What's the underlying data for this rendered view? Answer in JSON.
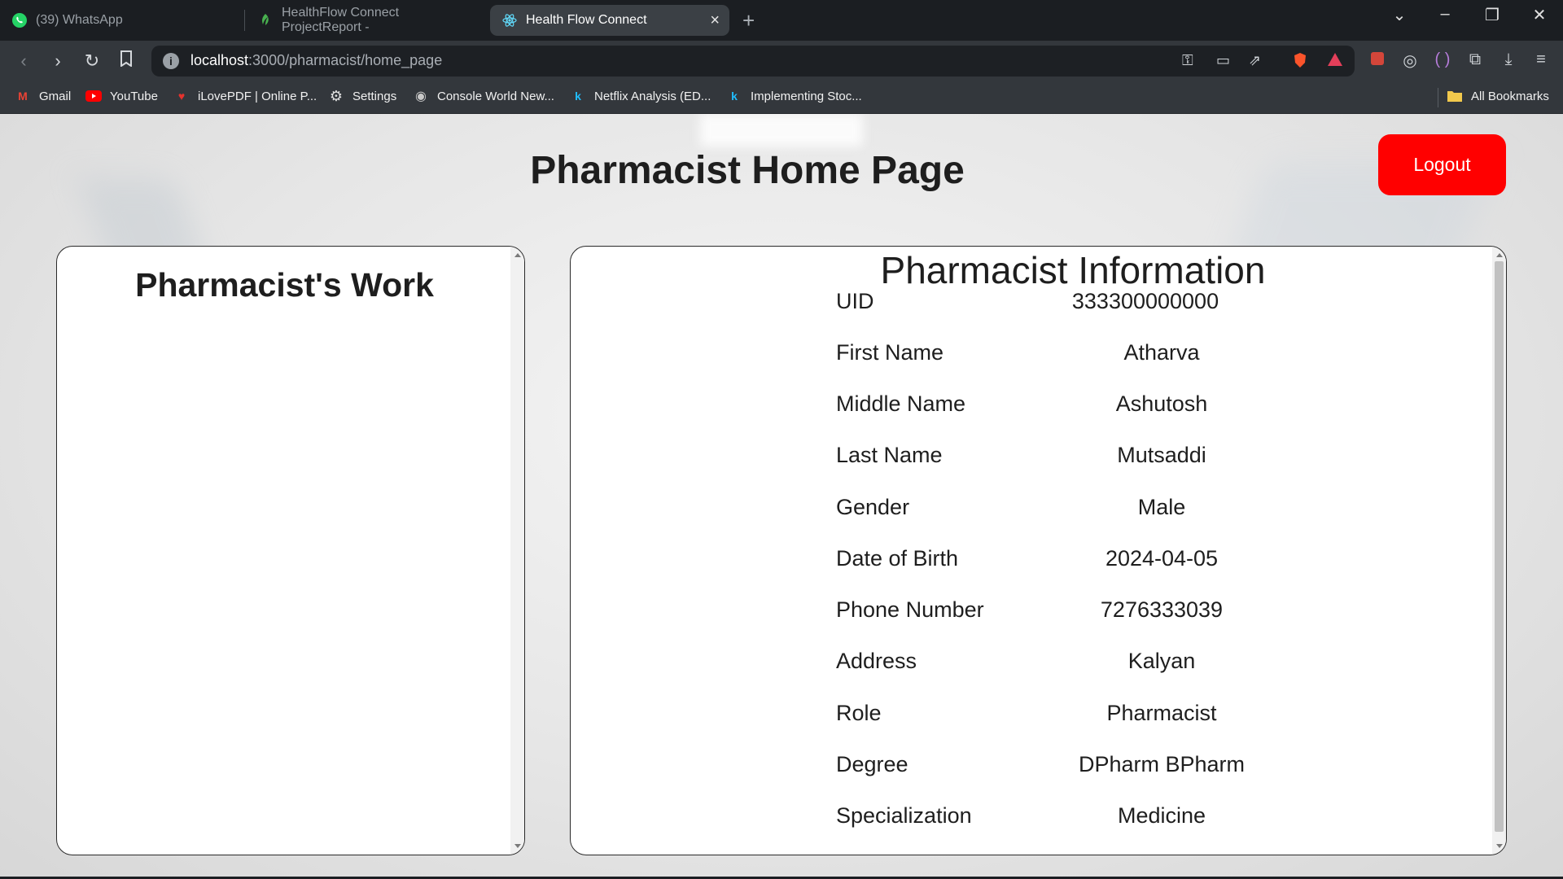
{
  "browser": {
    "tabs": [
      {
        "label": "(39) WhatsApp",
        "icon": "whatsapp-icon",
        "active": false
      },
      {
        "label": "HealthFlow Connect ProjectReport -",
        "icon": "leaf-icon",
        "active": false
      },
      {
        "label": "Health Flow Connect",
        "icon": "react-icon",
        "active": true
      }
    ],
    "url_host": "localhost",
    "url_rest": ":3000/pharmacist/home_page",
    "bookmarks": [
      {
        "label": "Gmail",
        "icon": "gmail-icon"
      },
      {
        "label": "YouTube",
        "icon": "youtube-icon"
      },
      {
        "label": "iLovePDF | Online P...",
        "icon": "ilovepdf-icon"
      },
      {
        "label": "Settings",
        "icon": "gear-icon"
      },
      {
        "label": "Console World New...",
        "icon": "globe-icon"
      },
      {
        "label": "Netflix Analysis (ED...",
        "icon": "kaggle-icon"
      },
      {
        "label": "Implementing Stoc...",
        "icon": "kaggle-icon"
      }
    ],
    "all_bookmarks": "All Bookmarks"
  },
  "page": {
    "title": "Pharmacist Home Page",
    "logout_label": "Logout",
    "left_heading": "Pharmacist's Work",
    "right_heading": "Pharmacist Information",
    "info": [
      {
        "label": "UID",
        "value": "333300000000"
      },
      {
        "label": "First Name",
        "value": "Atharva"
      },
      {
        "label": "Middle Name",
        "value": "Ashutosh"
      },
      {
        "label": "Last Name",
        "value": "Mutsaddi"
      },
      {
        "label": "Gender",
        "value": "Male"
      },
      {
        "label": "Date of Birth",
        "value": "2024-04-05"
      },
      {
        "label": "Phone Number",
        "value": "7276333039"
      },
      {
        "label": "Address",
        "value": "Kalyan"
      },
      {
        "label": "Role",
        "value": "Pharmacist"
      },
      {
        "label": "Degree",
        "value": "DPharm BPharm"
      },
      {
        "label": "Specialization",
        "value": "Medicine"
      }
    ]
  },
  "colors": {
    "logout_bg": "#ff0000",
    "chrome_dark": "#1b1e22",
    "chrome_toolbar": "#33373c"
  }
}
